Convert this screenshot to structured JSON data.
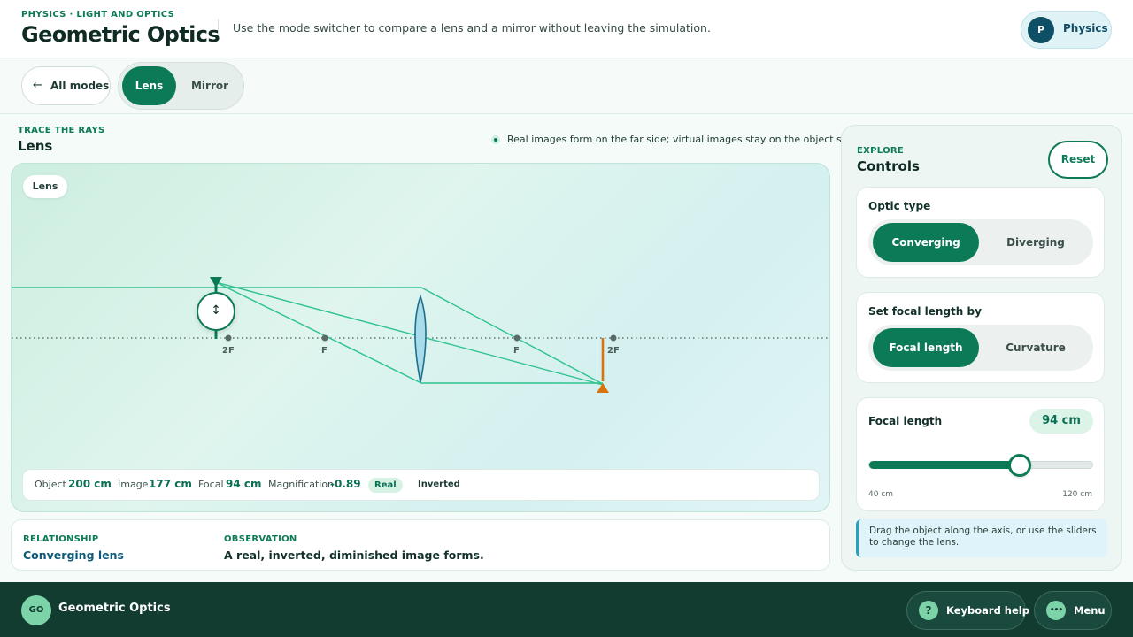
{
  "header": {
    "eyebrow": "PHYSICS · LIGHT AND OPTICS",
    "title": "Geometric Optics",
    "subtitle": "Use the mode switcher to compare a lens and a mirror without leaving the simulation.",
    "subject_initial": "P",
    "subject_label": "Physics"
  },
  "modebar": {
    "back_label": "All modes",
    "back_icon": "←",
    "modes": [
      {
        "label": "Lens",
        "active": true
      },
      {
        "label": "Mirror",
        "active": false
      }
    ]
  },
  "sim": {
    "eyebrow": "TRACE THE RAYS",
    "title": "Lens",
    "hint": "Real images form on the far side; virtual images stay on the object side.",
    "canvas_chip": "Lens",
    "handle_icon": "↕",
    "axis_labels": {
      "left_2f": "2F",
      "left_f": "F",
      "right_f": "F",
      "right_2f": "2F"
    },
    "readout": {
      "object_label": "Object",
      "object_value": "200 cm",
      "image_label": "Image",
      "image_value": "177 cm",
      "focal_label": "Focal",
      "focal_value": "94 cm",
      "magnification_label": "Magnification",
      "magnification_value": "-0.89",
      "badge_real": "Real",
      "badge_orientation": "Inverted"
    },
    "colors": {
      "ray": "#2fc28f",
      "object": "#0c7a57",
      "image": "#d9730d",
      "lens_fill": "#a9dcea",
      "lens_stroke": "#1f6f8b"
    }
  },
  "relationship": {
    "relationship_label": "RELATIONSHIP",
    "relationship_value": "Converging lens",
    "observation_label": "OBSERVATION",
    "observation_value": "A real, inverted, diminished image forms."
  },
  "controls": {
    "eyebrow": "EXPLORE",
    "title": "Controls",
    "reset_label": "Reset",
    "optic_type": {
      "label": "Optic type",
      "options": [
        "Converging",
        "Diverging"
      ],
      "selected": "Converging"
    },
    "focal_by": {
      "label": "Set focal length by",
      "options": [
        "Focal length",
        "Curvature"
      ],
      "selected": "Focal length"
    },
    "focal_length": {
      "label": "Focal length",
      "value_text": "94 cm",
      "value": 94,
      "min": 40,
      "max": 120,
      "min_label": "40 cm",
      "max_label": "120 cm"
    },
    "tip": "Drag the object along the axis, or use the sliders to change the lens."
  },
  "footer": {
    "logo": "GO",
    "title": "Geometric Optics",
    "keyboard_icon": "?",
    "keyboard_label": "Keyboard help",
    "menu_icon": "•••",
    "menu_label": "Menu"
  },
  "theme": {
    "accent": "#0c7a57",
    "footer_bg": "#123c30"
  }
}
